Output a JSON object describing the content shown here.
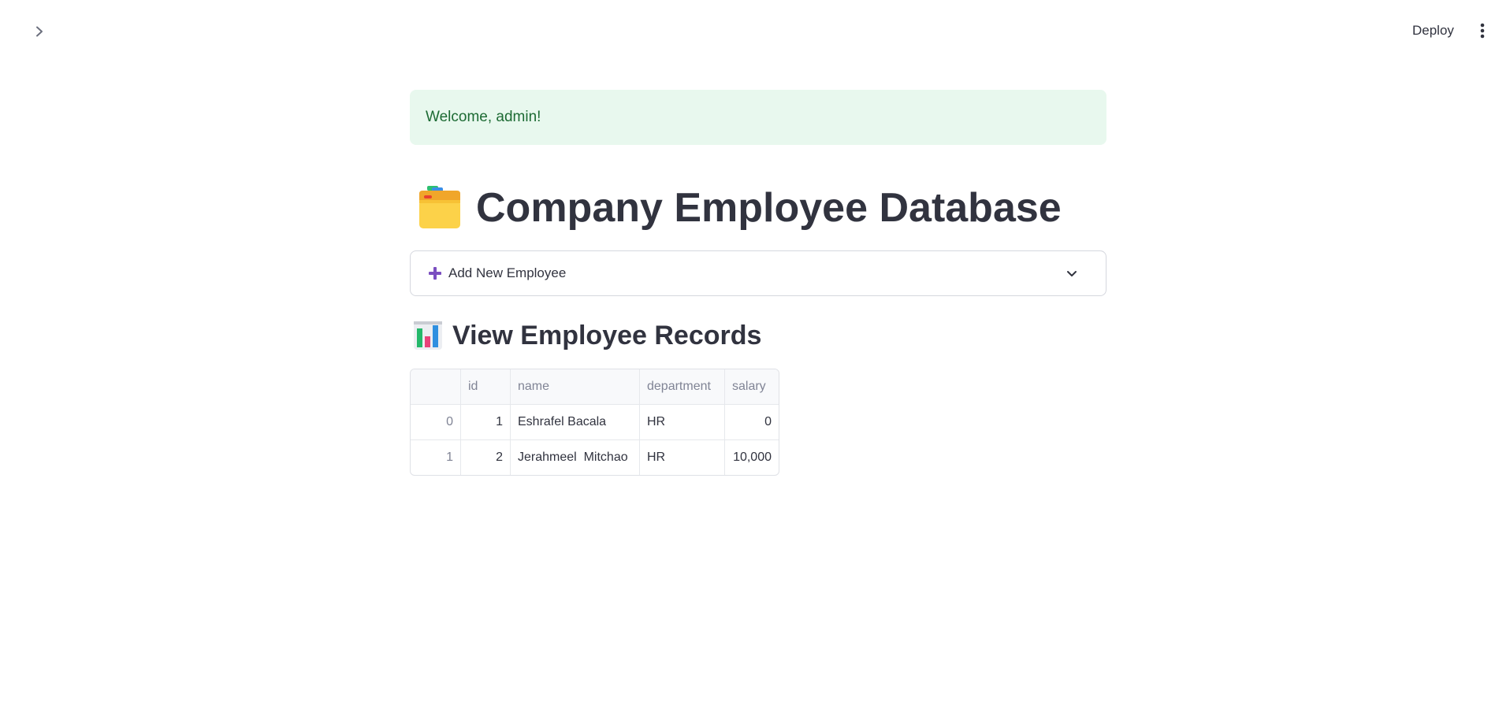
{
  "toolbar": {
    "deploy_label": "Deploy"
  },
  "alert": {
    "message": "Welcome, admin!",
    "accent": "#1d6b34",
    "background": "#e8f8ee"
  },
  "header": {
    "title": "Company Employee Database",
    "title_icon": "card-index-dividers-icon"
  },
  "expander": {
    "label": "Add New Employee",
    "icon": "plus-icon",
    "icon_color": "#7b4fc0"
  },
  "records": {
    "heading": "View Employee Records",
    "heading_icon": "bar-chart-icon",
    "columns": [
      "",
      "id",
      "name",
      "department",
      "salary"
    ],
    "rows": [
      {
        "index": "0",
        "id": "1",
        "name": "Eshrafel Bacala",
        "department": "HR",
        "salary": "0"
      },
      {
        "index": "1",
        "id": "2",
        "name": "Jerahmeel  Mitchao",
        "department": "HR",
        "salary": "10,000"
      }
    ]
  }
}
